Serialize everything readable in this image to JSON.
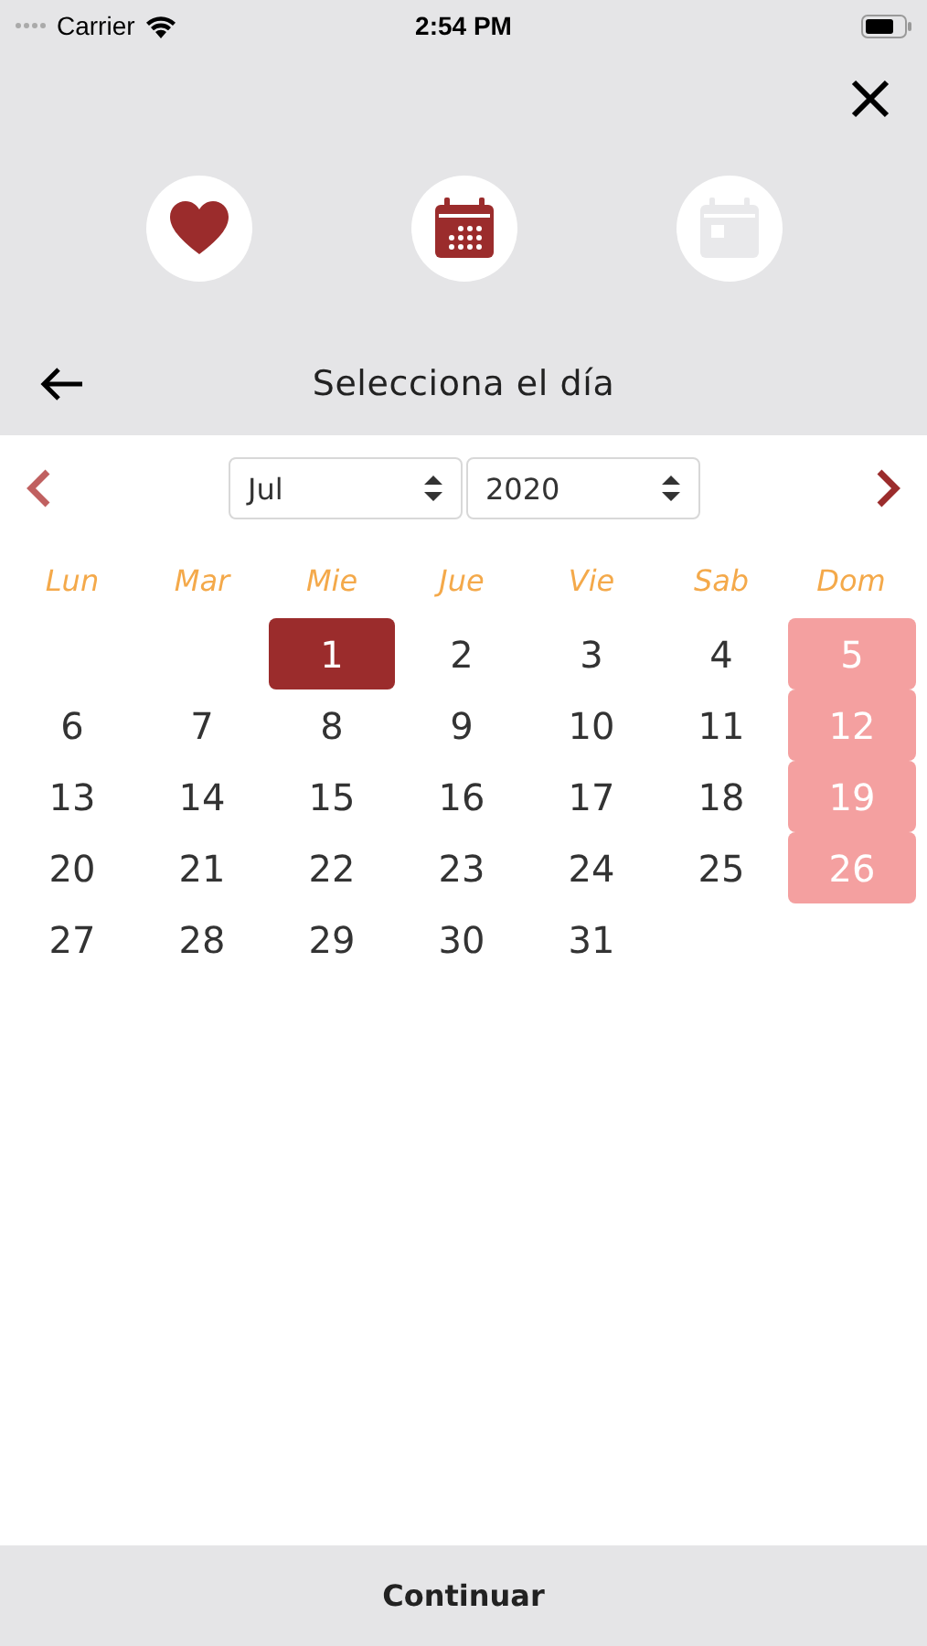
{
  "status_bar": {
    "carrier": "Carrier",
    "time": "2:54 PM"
  },
  "steps": [
    {
      "kind": "heart",
      "active": true
    },
    {
      "kind": "calendar",
      "active": true
    },
    {
      "kind": "day",
      "active": false
    }
  ],
  "header": {
    "title": "Selecciona el día"
  },
  "month_select": {
    "value": "Jul"
  },
  "year_select": {
    "value": "2020"
  },
  "weekdays": [
    "Lun",
    "Mar",
    "Mie",
    "Jue",
    "Vie",
    "Sab",
    "Dom"
  ],
  "weeks": [
    [
      {
        "kind": "blank"
      },
      {
        "kind": "blank"
      },
      {
        "kind": "day",
        "label": "1",
        "selected": true,
        "weekend": false
      },
      {
        "kind": "day",
        "label": "2",
        "selected": false,
        "weekend": false
      },
      {
        "kind": "day",
        "label": "3",
        "selected": false,
        "weekend": false
      },
      {
        "kind": "day",
        "label": "4",
        "selected": false,
        "weekend": false
      },
      {
        "kind": "day",
        "label": "5",
        "selected": false,
        "weekend": true
      }
    ],
    [
      {
        "kind": "day",
        "label": "6",
        "selected": false,
        "weekend": false
      },
      {
        "kind": "day",
        "label": "7",
        "selected": false,
        "weekend": false
      },
      {
        "kind": "day",
        "label": "8",
        "selected": false,
        "weekend": false
      },
      {
        "kind": "day",
        "label": "9",
        "selected": false,
        "weekend": false
      },
      {
        "kind": "day",
        "label": "10",
        "selected": false,
        "weekend": false
      },
      {
        "kind": "day",
        "label": "11",
        "selected": false,
        "weekend": false
      },
      {
        "kind": "day",
        "label": "12",
        "selected": false,
        "weekend": true
      }
    ],
    [
      {
        "kind": "day",
        "label": "13",
        "selected": false,
        "weekend": false
      },
      {
        "kind": "day",
        "label": "14",
        "selected": false,
        "weekend": false
      },
      {
        "kind": "day",
        "label": "15",
        "selected": false,
        "weekend": false
      },
      {
        "kind": "day",
        "label": "16",
        "selected": false,
        "weekend": false
      },
      {
        "kind": "day",
        "label": "17",
        "selected": false,
        "weekend": false
      },
      {
        "kind": "day",
        "label": "18",
        "selected": false,
        "weekend": false
      },
      {
        "kind": "day",
        "label": "19",
        "selected": false,
        "weekend": true
      }
    ],
    [
      {
        "kind": "day",
        "label": "20",
        "selected": false,
        "weekend": false
      },
      {
        "kind": "day",
        "label": "21",
        "selected": false,
        "weekend": false
      },
      {
        "kind": "day",
        "label": "22",
        "selected": false,
        "weekend": false
      },
      {
        "kind": "day",
        "label": "23",
        "selected": false,
        "weekend": false
      },
      {
        "kind": "day",
        "label": "24",
        "selected": false,
        "weekend": false
      },
      {
        "kind": "day",
        "label": "25",
        "selected": false,
        "weekend": false
      },
      {
        "kind": "day",
        "label": "26",
        "selected": false,
        "weekend": true
      }
    ],
    [
      {
        "kind": "day",
        "label": "27",
        "selected": false,
        "weekend": false
      },
      {
        "kind": "day",
        "label": "28",
        "selected": false,
        "weekend": false
      },
      {
        "kind": "day",
        "label": "29",
        "selected": false,
        "weekend": false
      },
      {
        "kind": "day",
        "label": "30",
        "selected": false,
        "weekend": false
      },
      {
        "kind": "day",
        "label": "31",
        "selected": false,
        "weekend": false
      },
      {
        "kind": "blank"
      },
      {
        "kind": "blank"
      }
    ]
  ],
  "footer": {
    "button": "Continuar"
  }
}
